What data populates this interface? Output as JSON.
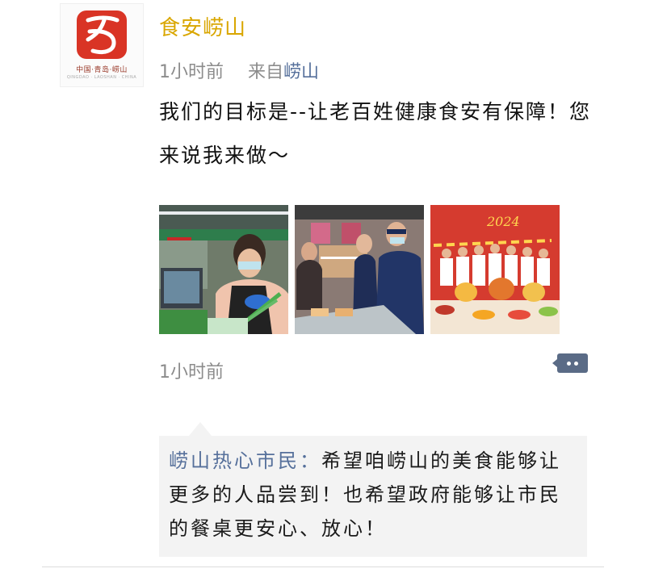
{
  "post": {
    "author": "食安崂山",
    "avatar": {
      "logo_text": "中国·青岛·崂山",
      "logo_sub": "QINGDAO · LAOSHAN · CHINA",
      "brand_color": "#d93425"
    },
    "time": "1小时前",
    "source_prefix": "来自",
    "source_name": "崂山",
    "content": "我们的目标是--让老百姓健康食安有保障！您来说我来做～",
    "photos": [
      {
        "label": "vendor-at-vegetable-market"
      },
      {
        "label": "inspectors-at-bakery"
      },
      {
        "label": "chefs-with-dishes-banner"
      }
    ],
    "footer_time": "1小时前"
  },
  "comments": [
    {
      "user": "崂山热心市民",
      "separator": "：",
      "text": "希望咱崂山的美食能够让更多的人品尝到！也希望政府能够让市民的餐桌更安心、放心！"
    }
  ],
  "colors": {
    "author": "#d9a600",
    "link": "#56709b",
    "meta": "#8c8c8c",
    "comment_bg": "#f3f3f3"
  }
}
